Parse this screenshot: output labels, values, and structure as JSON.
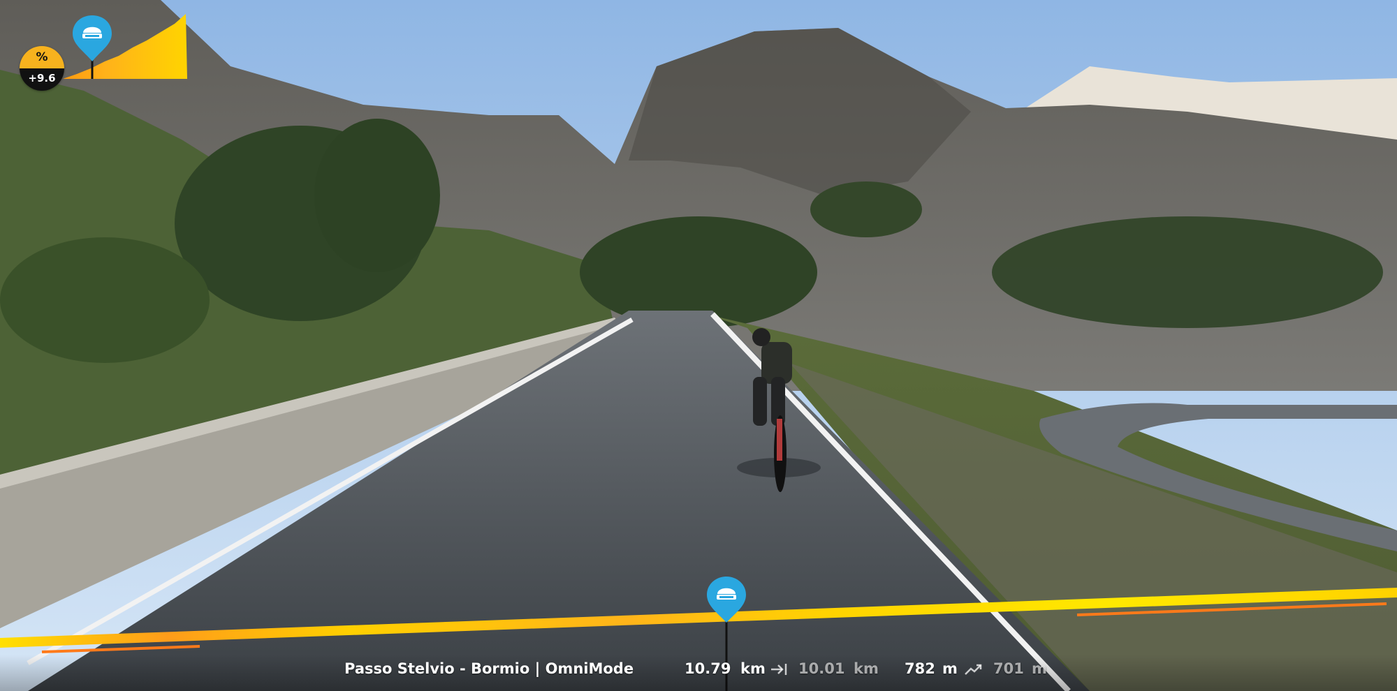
{
  "app": {
    "gradient_meter": {
      "symbol": "%",
      "value": "+9.6",
      "rider_icon": "rider-helmet-icon",
      "colors": {
        "badge_top": "#f7b21e",
        "badge_bottom": "#111111",
        "profile_fill": "#f5c400",
        "marker": "#2aa7e0"
      }
    },
    "route": {
      "name": "Passo Stelvio - Bormio | OmniMode",
      "distance_done": "10.79",
      "distance_done_unit": "km",
      "distance_icon": "arrow-to-end-icon",
      "distance_remaining": "10.01",
      "distance_remaining_unit": "km",
      "elevation_done": "782",
      "elevation_done_unit": "m",
      "elevation_icon": "ascent-trend-icon",
      "elevation_remaining": "701",
      "elevation_remaining_unit": "m",
      "progress": 0.52,
      "progress_marker_icon": "rider-helmet-icon",
      "colors": {
        "bar_yellow": "#ffd400",
        "bar_orange": "#ff8a1c",
        "marker": "#2aa7e0"
      }
    }
  }
}
